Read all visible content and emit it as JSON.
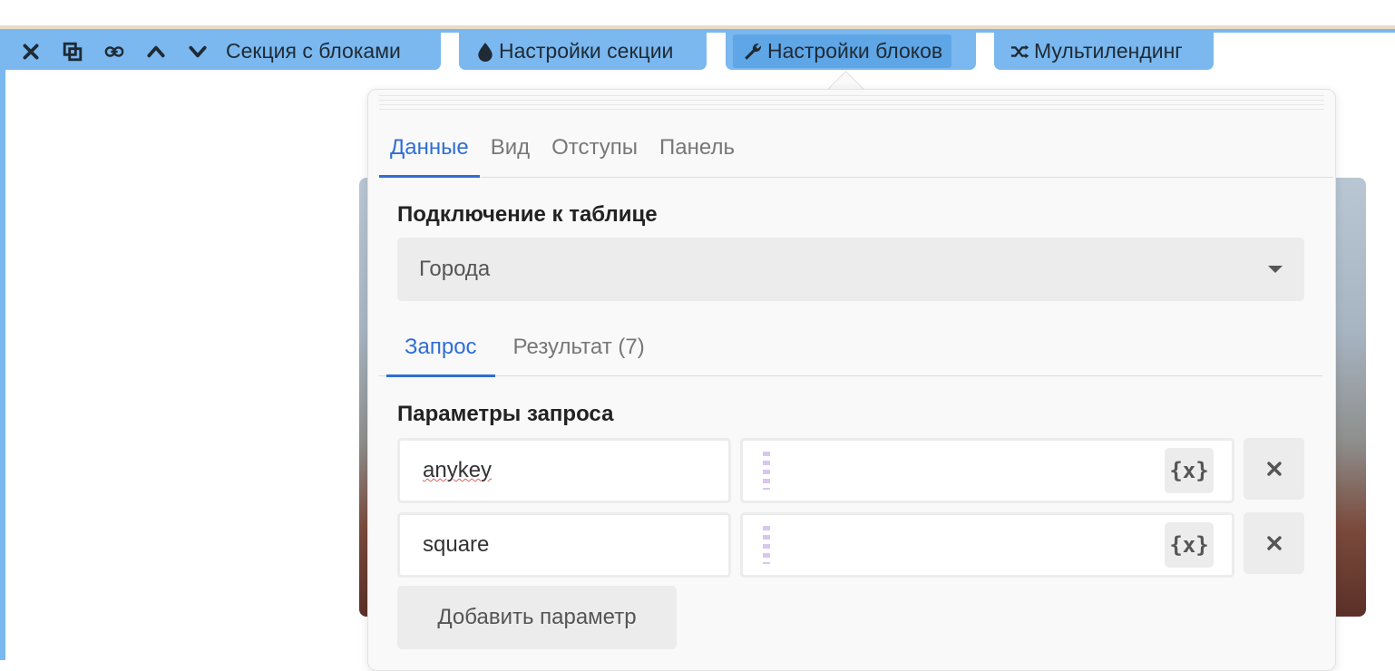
{
  "toolbar": {
    "section_label": "Секция с блоками",
    "section_settings_label": "Настройки секции",
    "block_settings_label": "Настройки блоков",
    "multilanding_label": "Мультилендинг"
  },
  "panel": {
    "tabs": [
      {
        "label": "Данные",
        "active": true
      },
      {
        "label": "Вид",
        "active": false
      },
      {
        "label": "Отступы",
        "active": false
      },
      {
        "label": "Панель",
        "active": false
      }
    ],
    "table_connection_title": "Подключение к таблице",
    "table_select_value": "Города",
    "subtabs": [
      {
        "label": "Запрос",
        "active": true
      },
      {
        "label": "Результат (7)",
        "active": false
      }
    ],
    "query_params_title": "Параметры запроса",
    "params": [
      {
        "key": "anykey",
        "value": "",
        "var_label": "{x}"
      },
      {
        "key": "square",
        "value": "",
        "var_label": "{x}"
      }
    ],
    "add_param_label": "Добавить параметр"
  },
  "colors": {
    "accent": "#2f6ed6",
    "toolbar_bg": "#7ab8ef",
    "toolbar_active": "#5ea6e6"
  }
}
